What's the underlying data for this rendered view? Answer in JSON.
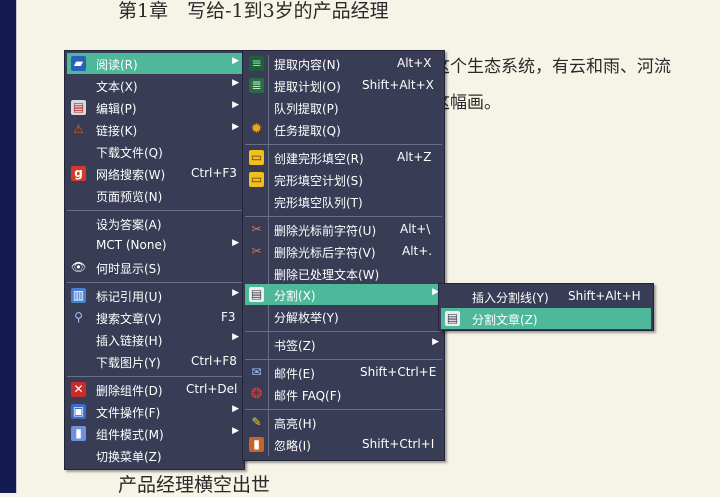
{
  "document": {
    "chapter_heading": "第1章　写给-1到3岁的产品经理",
    "para_line1": "这个生态系统，有云和雨、河流",
    "para_line2": "这幅画。",
    "footer_heading": "产品经理横空出世"
  },
  "main_menu": {
    "items": [
      {
        "label": "阅读(R)",
        "shortcut": "",
        "icon": "book-icon"
      },
      {
        "label": "文本(X)",
        "shortcut": "",
        "icon": ""
      },
      {
        "label": "编辑(P)",
        "shortcut": "",
        "icon": "clipboard-icon"
      },
      {
        "label": "链接(K)",
        "shortcut": "",
        "icon": "link-icon"
      },
      {
        "label": "下载文件(Q)",
        "shortcut": "",
        "icon": ""
      },
      {
        "label": "网络搜索(W)",
        "shortcut": "Ctrl+F3",
        "icon": "google-icon"
      },
      {
        "label": "页面预览(N)",
        "shortcut": "",
        "icon": ""
      },
      {
        "label": "设为答案(A)",
        "shortcut": "",
        "icon": ""
      },
      {
        "label": "MCT (None)",
        "shortcut": "",
        "icon": ""
      },
      {
        "label": "何时显示(S)",
        "shortcut": "",
        "icon": "eye-icon"
      },
      {
        "label": "标记引用(U)",
        "shortcut": "",
        "icon": "open-book-icon"
      },
      {
        "label": "搜索文章(V)",
        "shortcut": "F3",
        "icon": "magnifier-icon"
      },
      {
        "label": "插入链接(H)",
        "shortcut": "",
        "icon": ""
      },
      {
        "label": "下载图片(Y)",
        "shortcut": "Ctrl+F8",
        "icon": ""
      },
      {
        "label": "删除组件(D)",
        "shortcut": "Ctrl+Del",
        "icon": "delete-icon"
      },
      {
        "label": "文件操作(F)",
        "shortcut": "",
        "icon": "floppy-icon"
      },
      {
        "label": "组件模式(M)",
        "shortcut": "",
        "icon": "component-icon"
      },
      {
        "label": "切换菜单(Z)",
        "shortcut": "",
        "icon": ""
      }
    ]
  },
  "reading_menu": {
    "items": [
      {
        "label": "提取内容(N)",
        "shortcut": "Alt+X",
        "icon": "extract-icon"
      },
      {
        "label": "提取计划(O)",
        "shortcut": "Shift+Alt+X",
        "icon": "plan-icon"
      },
      {
        "label": "队列提取(P)",
        "shortcut": "",
        "icon": ""
      },
      {
        "label": "任务提取(Q)",
        "shortcut": "",
        "icon": "gear-icon"
      },
      {
        "label": "创建完形填空(R)",
        "shortcut": "Alt+Z",
        "icon": "cloze-icon"
      },
      {
        "label": "完形填空计划(S)",
        "shortcut": "",
        "icon": "cloze-plan-icon"
      },
      {
        "label": "完形填空队列(T)",
        "shortcut": "",
        "icon": ""
      },
      {
        "label": "删除光标前字符(U)",
        "shortcut": "Alt+\\",
        "icon": "cut-before-icon"
      },
      {
        "label": "删除光标后字符(V)",
        "shortcut": "Alt+.",
        "icon": "cut-after-icon"
      },
      {
        "label": "删除已处理文本(W)",
        "shortcut": "",
        "icon": ""
      },
      {
        "label": "分割(X)",
        "shortcut": "",
        "icon": "split-icon"
      },
      {
        "label": "分解枚举(Y)",
        "shortcut": "",
        "icon": ""
      },
      {
        "label": "书签(Z)",
        "shortcut": "",
        "icon": ""
      },
      {
        "label": "邮件(E)",
        "shortcut": "Shift+Ctrl+E",
        "icon": "mail-icon"
      },
      {
        "label": "邮件 FAQ(F)",
        "shortcut": "",
        "icon": "lifebuoy-icon"
      },
      {
        "label": "高亮(H)",
        "shortcut": "",
        "icon": "highlighter-icon"
      },
      {
        "label": "忽略(I)",
        "shortcut": "Shift+Ctrl+I",
        "icon": "ignore-icon"
      }
    ]
  },
  "split_menu": {
    "items": [
      {
        "label": "插入分割线(Y)",
        "shortcut": "Shift+Alt+H",
        "icon": ""
      },
      {
        "label": "分割文章(Z)",
        "shortcut": "",
        "icon": "split-article-icon"
      }
    ]
  },
  "colors": {
    "menu_bg": "#383c55",
    "highlight": "#4fb89a",
    "page_bg": "#f6f3e7",
    "left_bar": "#141a52"
  }
}
